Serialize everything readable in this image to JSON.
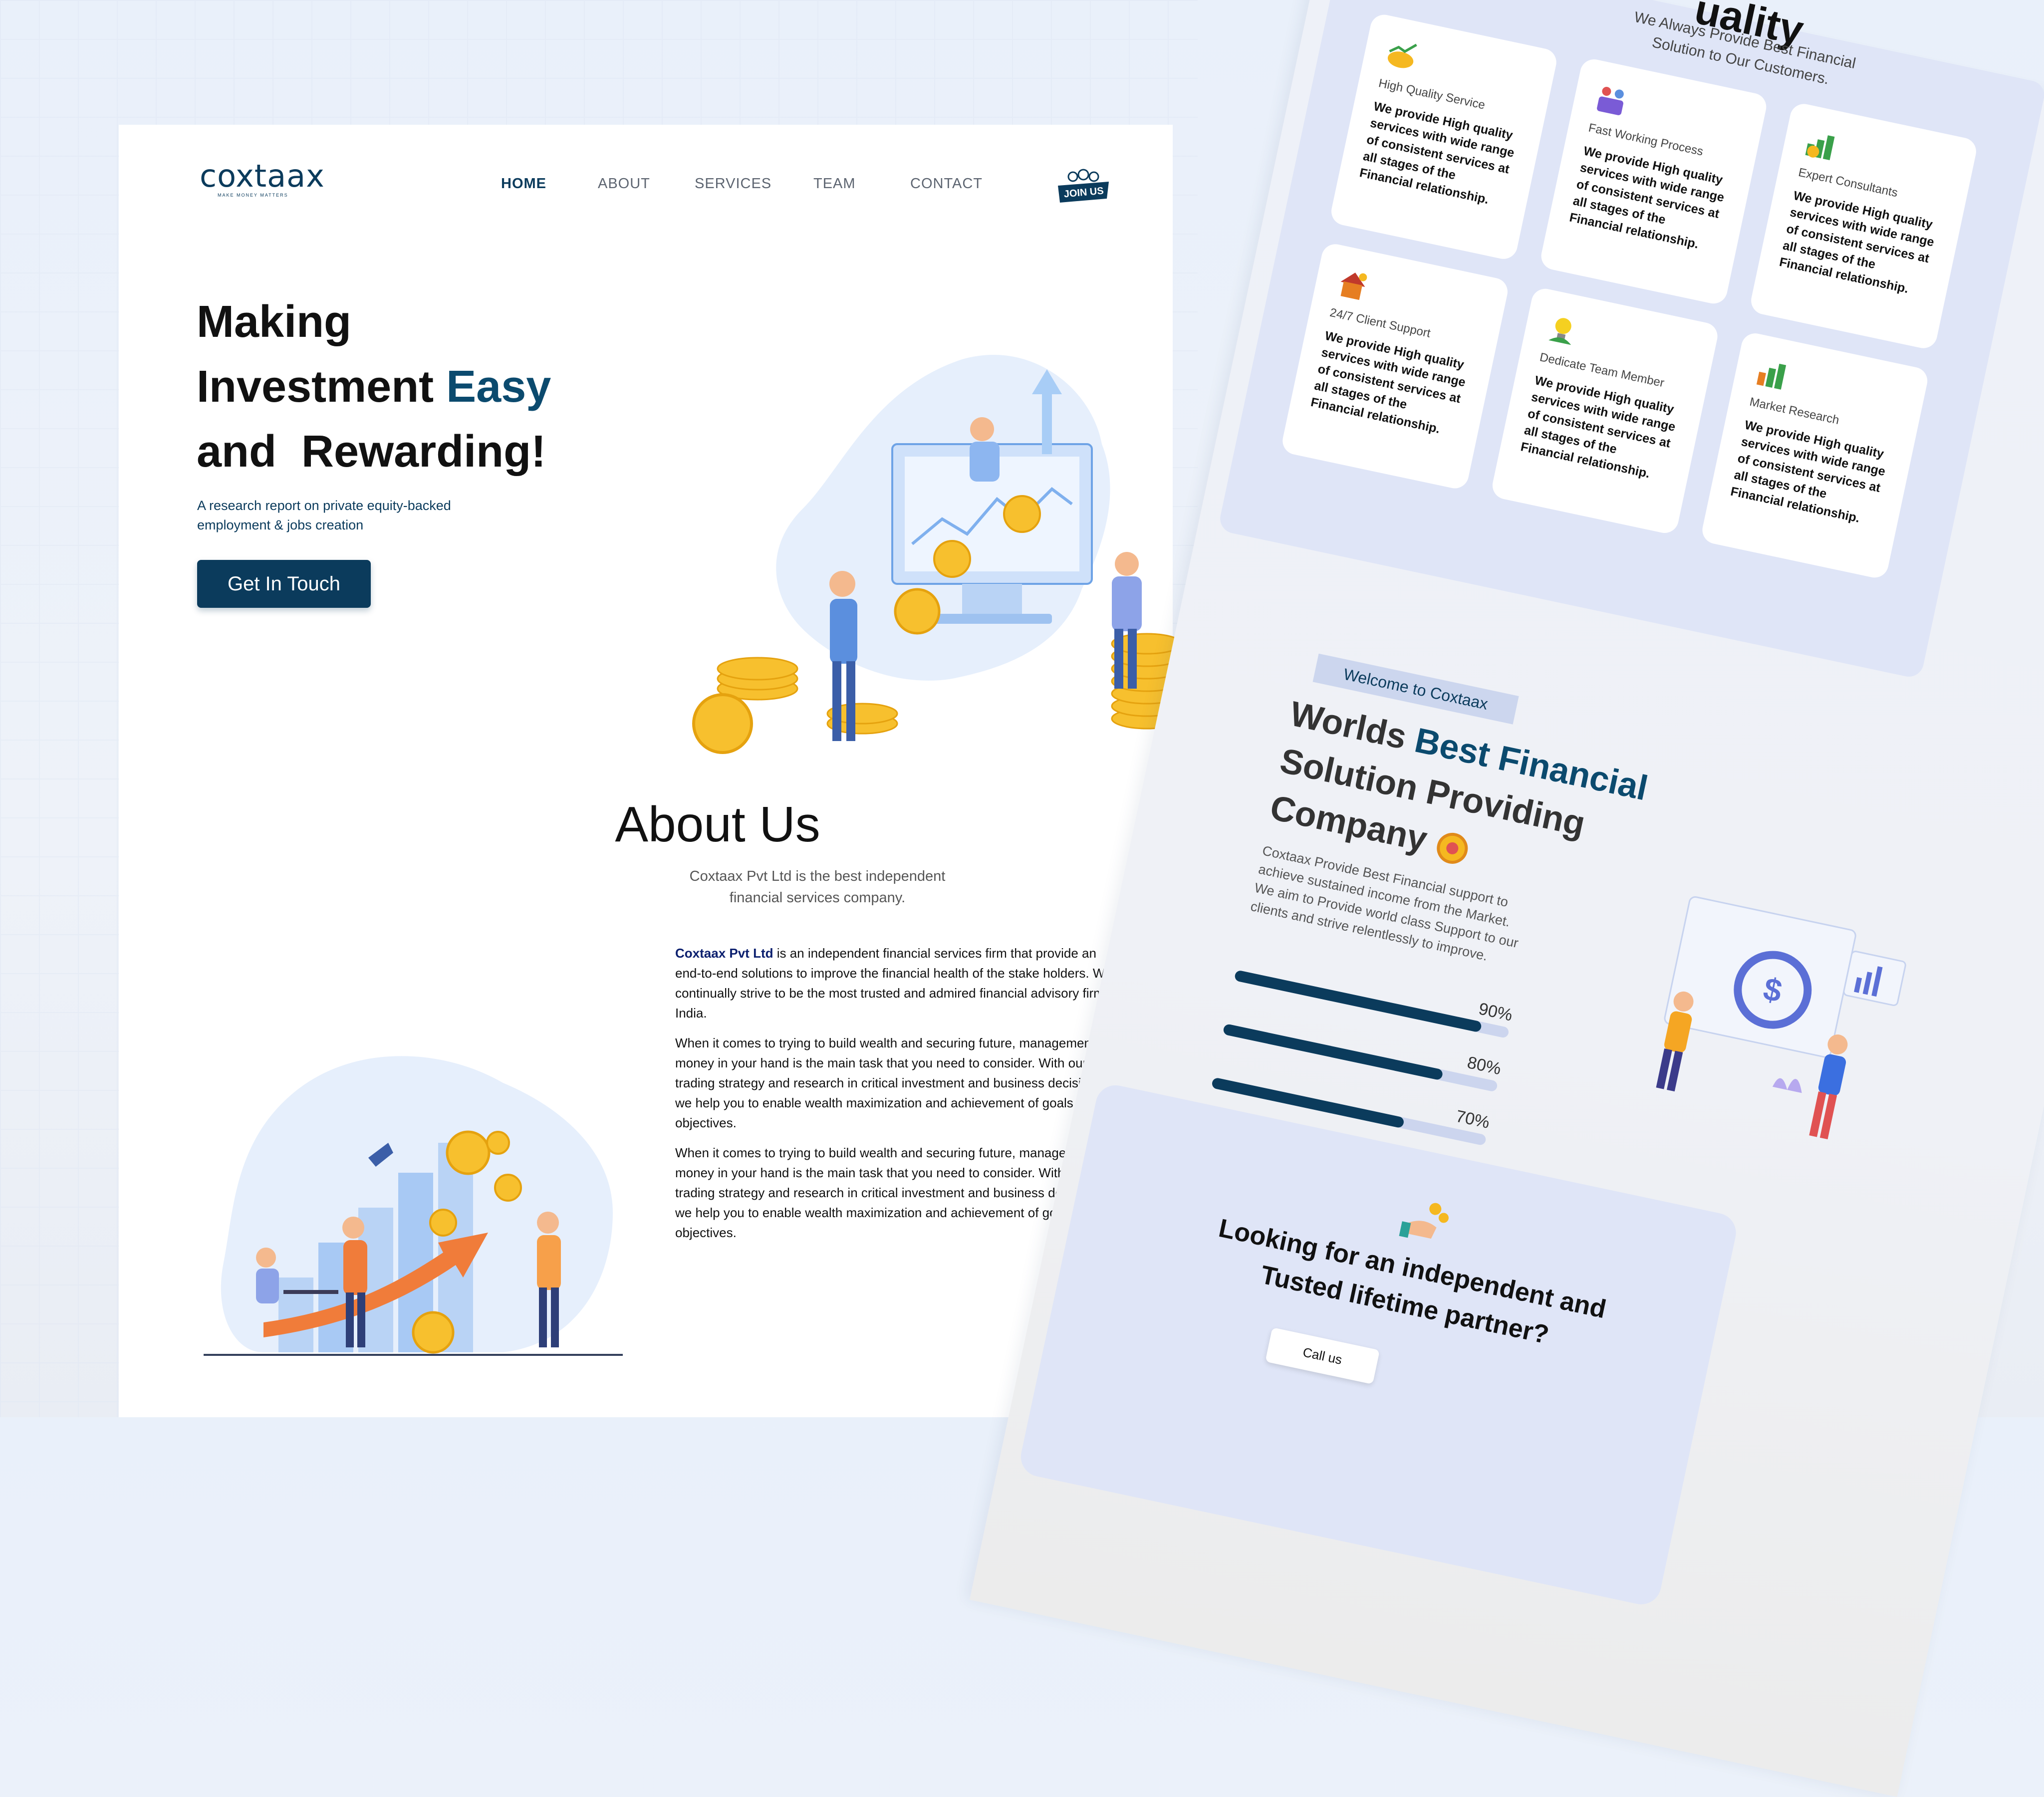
{
  "header": {
    "logo_text": "coxtaax",
    "logo_tagline": "MAKE MONEY MATTERS",
    "nav": [
      "HOME",
      "ABOUT",
      "SERVICES",
      "TEAM",
      "CONTACT"
    ],
    "active_nav": "HOME",
    "join_badge": "JOIN US"
  },
  "hero": {
    "title_line1": "Making",
    "title_line2_a": "Investment",
    "title_line2_b": "Easy",
    "title_line3": "and  Rewarding!",
    "subtitle": "A research report on private equity-backed employment & jobs creation",
    "cta": "Get In Touch"
  },
  "about": {
    "title": "About Us",
    "subtitle": "Coxtaax Pvt Ltd is the best independent financial services company.",
    "brand": "Coxtaax Pvt Ltd",
    "para1_rest": " is an independent financial services firm that provide an end-to-end solutions to improve the financial health of the stake holders. We continually strive to be the most trusted and admired financial advisory firm in India.",
    "para2": "When it comes to trying to build wealth and securing future, management of money in your hand is the main task that you need to consider. With our trading strategy and research in critical investment and business decisions, we help you to enable wealth maximization and achievement of goals and objectives.",
    "para3": "When it comes to trying to build wealth and securing future, management of money in your hand is the main task that you need to consider. With our trading strategy and research in critical investment and business decisions, we help you to enable wealth maximization and achievement of goals and objectives."
  },
  "services": {
    "title_partial": "uality",
    "tagline": "We Always Provide Best Financial Solution to Our Customers.",
    "cards": [
      {
        "name": "High Quality Service",
        "desc": "We provide High quality services with wide range of consistent services at all stages of the Financial relationship.",
        "icon": "money-growth-icon"
      },
      {
        "name": "Fast Working Process",
        "desc": "We provide High quality services with wide range of consistent services at all stages of the Financial relationship.",
        "icon": "team-icon"
      },
      {
        "name": "Expert Consultants",
        "desc": "We provide High quality services with wide range of consistent services at all stages of the Financial relationship.",
        "icon": "chart-icon"
      },
      {
        "name": "24/7 Client Support",
        "desc": "We provide High quality services with wide range of consistent services at all stages of the Financial relationship.",
        "icon": "home-icon"
      },
      {
        "name": "Dedicate Team Member",
        "desc": "We provide High quality services with wide range of consistent services at all stages of the Financial relationship.",
        "icon": "bulb-icon"
      },
      {
        "name": "Market Research",
        "desc": "We provide High quality services with wide range of consistent services at all stages of the Financial relationship.",
        "icon": "bar-chart-icon"
      }
    ]
  },
  "welcome": {
    "tag": "Welcome to Coxtaax",
    "head_a": "Worlds ",
    "head_b": "Best Financial",
    "head_c": "Solution Providing",
    "head_d": "Company",
    "desc": "Coxtaax Provide Best Financial support to achieve sustained income from the Market. We aim to Provide world class Support to our clients and strive relentlessly to improve.",
    "bars": [
      {
        "label": "90%",
        "value": 0.9
      },
      {
        "label": "80%",
        "value": 0.8
      },
      {
        "label": "70%",
        "value": 0.7
      }
    ]
  },
  "partner": {
    "text_line1": "Looking for an independent and",
    "text_line2": "Tusted lifetime partner?",
    "button": "Call us"
  },
  "colors": {
    "primary": "#0b3b5c",
    "accent": "#0b4a6e",
    "gold": "#f5b820",
    "panel": "#dfe5f7"
  }
}
